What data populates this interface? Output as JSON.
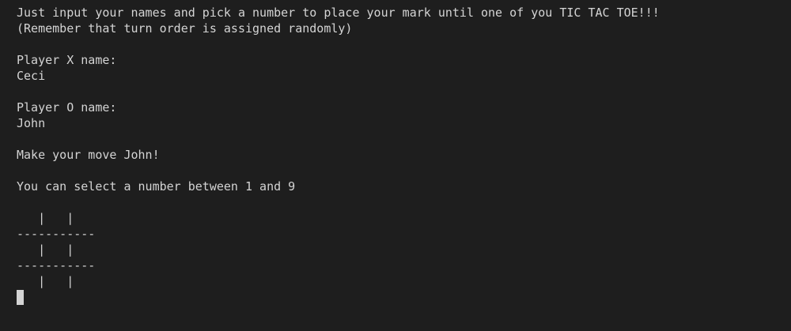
{
  "terminal": {
    "lines": [
      "Just input your names and pick a number to place your mark until one of you TIC TAC TOE!!!",
      "(Remember that turn order is assigned randomly)",
      "",
      "Player X name:",
      "Ceci",
      "",
      "Player O name:",
      "John",
      "",
      "Make your move John!",
      "",
      "You can select a number between 1 and 9",
      "",
      "   |   |",
      "-----------",
      "   |   |",
      "-----------",
      "   |   |"
    ],
    "colors": {
      "background": "#1e1e1e",
      "foreground": "#d4d4d4"
    }
  }
}
